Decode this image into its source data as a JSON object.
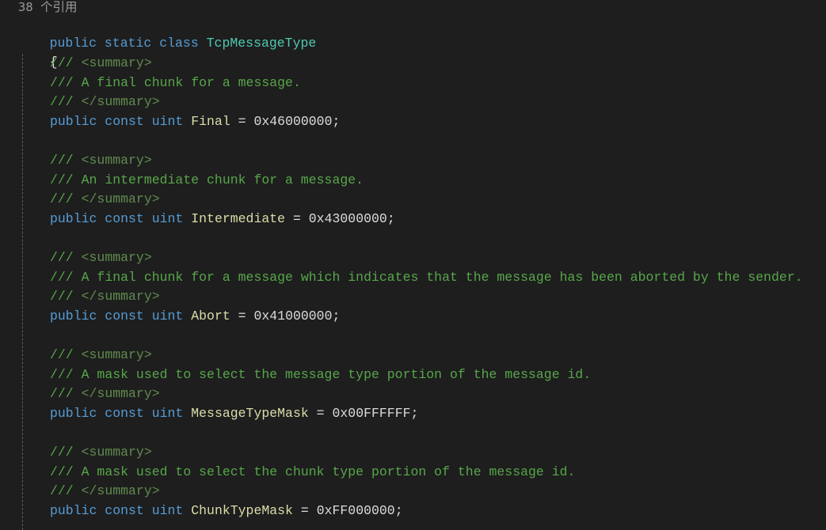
{
  "codelens": "38 个引用",
  "class_decl": {
    "modifiers": "public static class ",
    "name": "TcpMessageType"
  },
  "open_brace": "{",
  "comment_prefix": "/// ",
  "summary_open": "<summary>",
  "summary_close": "</summary>",
  "const_keywords": "public const uint ",
  "members": [
    {
      "comment": "A final chunk for a message.",
      "name": "Final",
      "value": "0x46000000"
    },
    {
      "comment": "An intermediate chunk for a message.",
      "name": "Intermediate",
      "value": "0x43000000"
    },
    {
      "comment": "A final chunk for a message which indicates that the message has been aborted by the sender.",
      "name": "Abort",
      "value": "0x41000000"
    },
    {
      "comment": "A mask used to select the message type portion of the message id.",
      "name": "MessageTypeMask",
      "value": "0x00FFFFFF"
    },
    {
      "comment": "A mask used to select the chunk type portion of the message id.",
      "name": "ChunkTypeMask",
      "value": "0xFF000000"
    }
  ],
  "colors": {
    "background": "#1e1e1e",
    "keyword": "#569cd6",
    "type": "#4ec9b0",
    "field": "#dcdcaa",
    "comment": "#57a64a",
    "codelens": "#999999"
  }
}
